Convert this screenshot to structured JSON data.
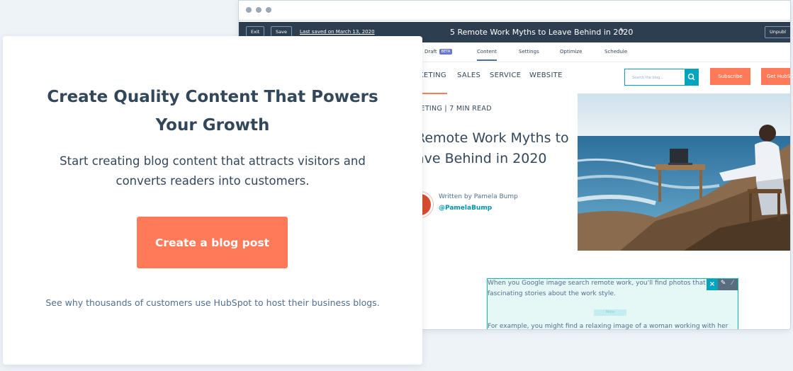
{
  "editor": {
    "toolbar": {
      "exit_label": "Exit",
      "save_label": "Save",
      "last_saved": "Last saved on March 13, 2020",
      "post_title": "5 Remote Work Myths to Leave Behind in 2020",
      "unpublish_label": "Unpubl"
    },
    "tabs": {
      "draft": "Draft",
      "beta": "BETA",
      "content": "Content",
      "settings": "Settings",
      "optimize": "Optimize",
      "schedule": "Schedule"
    },
    "blog_nav": {
      "items": [
        "KETING",
        "SALES",
        "SERVICE",
        "WEBSITE"
      ],
      "search_placeholder": "Search the blog...",
      "subscribe_label": "Subscribe",
      "get_label": "Get HubSp"
    },
    "post": {
      "meta": "KETING | 7 MIN READ",
      "title_line1": "Remote Work Myths to",
      "title_line2": "ave Behind in 2020",
      "author_by": "Written by Pamela Bump",
      "author_handle": "@PamelaBump"
    },
    "text_block": {
      "line1": "When you Google image search remote work, you'll find photos that",
      "line2": "fascinating stories about the work style.",
      "more": "More",
      "line3": "For example, you might find a relaxing image of a woman working with her"
    }
  },
  "card": {
    "title": "Create Quality Content That Powers Your Growth",
    "description": "Start creating blog content that attracts visitors and converts readers into customers.",
    "cta_label": "Create a blog post",
    "footer": "See why thousands of customers use HubSpot to host their business blogs."
  },
  "colors": {
    "accent": "#ff7a59",
    "teal": "#00a4bd",
    "dark_nav": "#2d3e50",
    "text": "#33475b"
  }
}
